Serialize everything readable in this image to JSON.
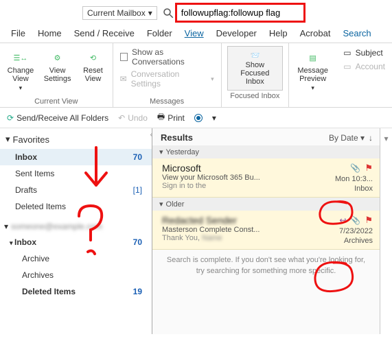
{
  "top": {
    "mailbox_selector": "Current Mailbox",
    "search_value": "followupflag:followup flag"
  },
  "menu": {
    "file": "File",
    "home": "Home",
    "sendrecv": "Send / Receive",
    "folder": "Folder",
    "view": "View",
    "developer": "Developer",
    "help": "Help",
    "acrobat": "Acrobat",
    "search": "Search"
  },
  "ribbon": {
    "change_view": "Change View",
    "view_settings": "View Settings",
    "reset_view": "Reset View",
    "current_view_label": "Current View",
    "show_as_conv": "Show as Conversations",
    "conv_settings": "Conversation Settings",
    "messages_label": "Messages",
    "show_focused": "Show Focused Inbox",
    "focused_label": "Focused Inbox",
    "msg_preview": "Message Preview",
    "subject": "Subject",
    "account": "Account"
  },
  "toolbar2": {
    "sendrecv_all": "Send/Receive All Folders",
    "undo": "Undo",
    "print": "Print"
  },
  "nav": {
    "favorites": "Favorites",
    "inbox": "Inbox",
    "inbox_count": "70",
    "sent": "Sent Items",
    "drafts": "Drafts",
    "drafts_count": "[1]",
    "deleted": "Deleted Items",
    "acct_blur": "someone@example.com",
    "sub_inbox": "Inbox",
    "sub_inbox_count": "70",
    "sub_archive": "Archive",
    "sub_archives": "Archives",
    "sub_deleted": "Deleted Items",
    "sub_deleted_count": "19"
  },
  "results": {
    "title": "Results",
    "sort": "By Date",
    "grp1": "Yesterday",
    "c1_from": "Microsoft",
    "c1_subj": "View your Microsoft 365 Bu...",
    "c1_prev": "Sign in to the",
    "c1_time": "Mon 10:3...",
    "c1_folder": "Inbox",
    "grp2": "Older",
    "c2_from": "Redacted Sender",
    "c2_subj": "Masterson Complete Const...",
    "c2_prev": "Thank You,",
    "c2_time": "7/23/2022",
    "c2_folder": "Archives",
    "done": "Search is complete. If you don't see what you're looking for, try searching for something more specific."
  }
}
